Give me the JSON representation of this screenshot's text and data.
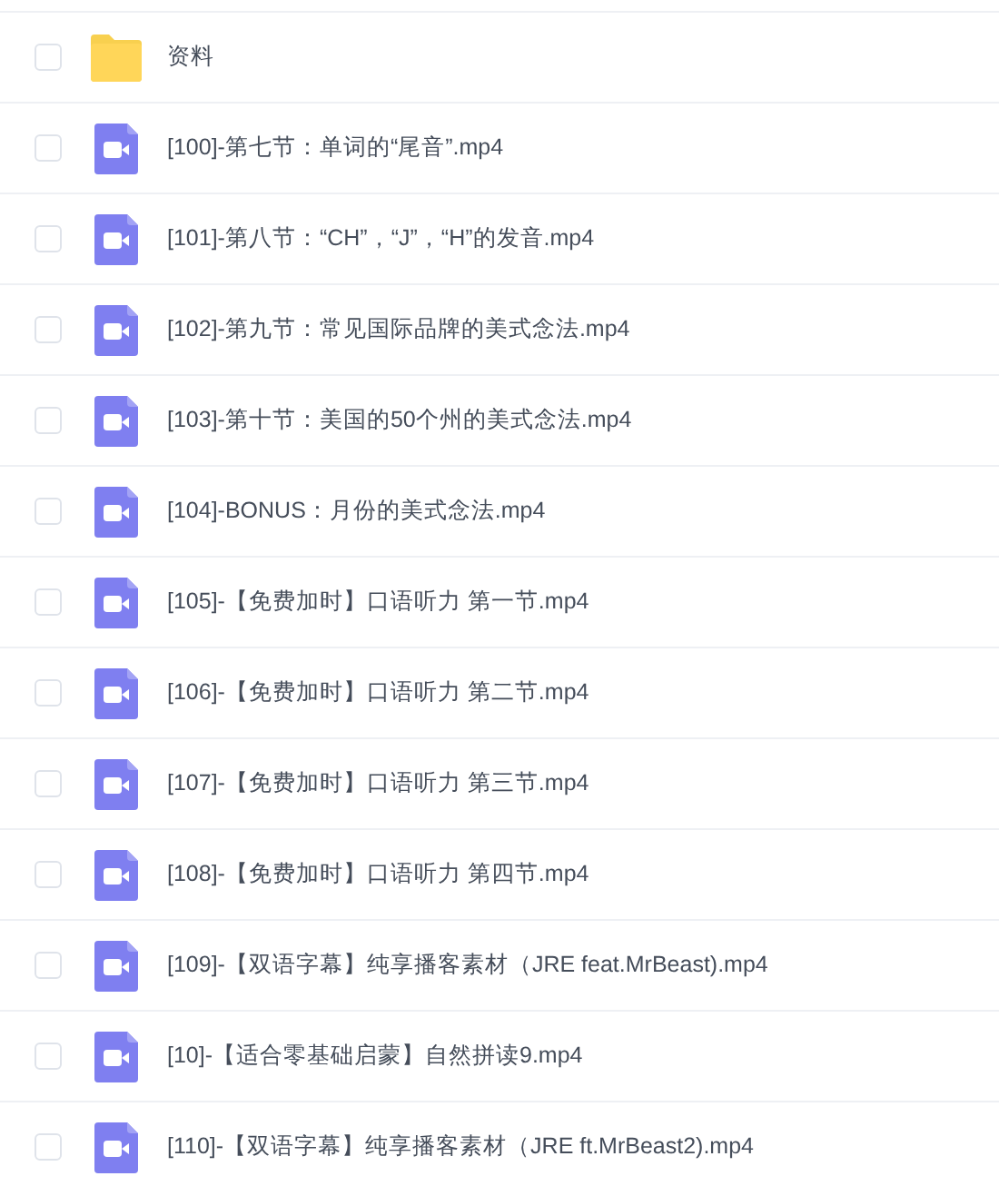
{
  "files": [
    {
      "kind": "folder",
      "name": "资料",
      "checked": false
    },
    {
      "kind": "video",
      "name": "[100]-第七节：单词的“尾音”.mp4",
      "checked": false
    },
    {
      "kind": "video",
      "name": "[101]-第八节：“CH”，“J”，“H”的发音.mp4",
      "checked": false
    },
    {
      "kind": "video",
      "name": "[102]-第九节：常见国际品牌的美式念法.mp4",
      "checked": false
    },
    {
      "kind": "video",
      "name": "[103]-第十节：美国的50个州的美式念法.mp4",
      "checked": false
    },
    {
      "kind": "video",
      "name": "[104]-BONUS：月份的美式念法.mp4",
      "checked": false
    },
    {
      "kind": "video",
      "name": "[105]-【免费加时】口语听力 第一节.mp4",
      "checked": false
    },
    {
      "kind": "video",
      "name": "[106]-【免费加时】口语听力 第二节.mp4",
      "checked": false
    },
    {
      "kind": "video",
      "name": "[107]-【免费加时】口语听力 第三节.mp4",
      "checked": false
    },
    {
      "kind": "video",
      "name": "[108]-【免费加时】口语听力 第四节.mp4",
      "checked": false
    },
    {
      "kind": "video",
      "name": "[109]-【双语字幕】纯享播客素材（JRE feat.MrBeast).mp4",
      "checked": false
    },
    {
      "kind": "video",
      "name": "[10]-【适合零基础启蒙】自然拼读9.mp4",
      "checked": false
    },
    {
      "kind": "video",
      "name": "[110]-【双语字幕】纯享播客素材（JRE ft.MrBeast2).mp4",
      "checked": false
    }
  ]
}
